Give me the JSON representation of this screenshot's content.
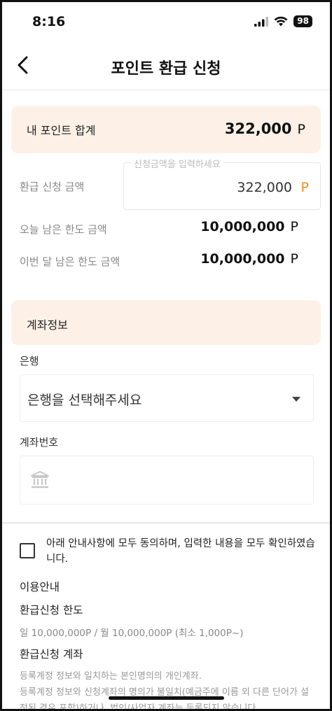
{
  "status_bar": {
    "time": "8:16",
    "battery": "98"
  },
  "header": {
    "title": "포인트 환급 신청"
  },
  "points_total": {
    "label": "내 포인트 합계",
    "value": "322,000",
    "unit": "P"
  },
  "refund": {
    "label": "환급 신청 금액",
    "placeholder": "신청금액을 입력하세요",
    "value": "322,000",
    "unit": "P"
  },
  "limits": [
    {
      "label": "오늘 남은 한도 금액",
      "value": "10,000,000",
      "unit": "P"
    },
    {
      "label": "이번 달 남은 한도 금액",
      "value": "10,000,000",
      "unit": "P"
    }
  ],
  "account": {
    "title": "계좌정보",
    "bank_label": "은행",
    "bank_placeholder": "은행을 선택해주세요",
    "number_label": "계좌번호"
  },
  "agreement": {
    "text": "아래 안내사항에 모두 동의하며, 입력한 내용을 모두 확인하였습니다."
  },
  "info": {
    "title": "이용안내",
    "limit_title": "환급신청 한도",
    "limit_text": "일 10,000,000P / 월 10,000,000P (최소 1,000P~)",
    "account_title": "환급신청 계좌",
    "account_text_1": "등록계정 정보와 일치하는 본인명의의 개인계좌.",
    "account_text_2": "등록계정 정보와 신청계좌의 명의가 불일치(예금주에 이름 외 다른 단어가 설정된 경우 포함)하거나, 법인/사업자 계좌는 등록되지 않습니다."
  },
  "colors": {
    "accent": "#f08c1e",
    "panel_bg": "#fdf1e7"
  }
}
